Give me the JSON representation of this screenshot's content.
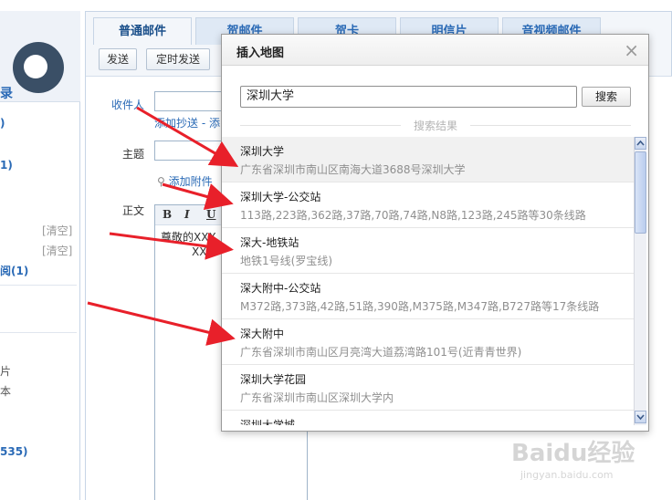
{
  "sidebar": {
    "logo_text": "录",
    "items": [
      {
        "text": ")"
      },
      {
        "text": "1)"
      },
      {
        "text": "[清空]"
      },
      {
        "text": "[清空]"
      },
      {
        "text": "阅(1)"
      },
      {
        "text": "片"
      },
      {
        "text": "本"
      },
      {
        "text": "535)"
      }
    ]
  },
  "tabs": [
    "普通邮件",
    "贺邮件",
    "贺卡",
    "明信片",
    "音视频邮件"
  ],
  "toolbar": {
    "send": "发送",
    "timed_send": "定时发送"
  },
  "compose": {
    "recipient_label": "收件人",
    "add_cc": "添加抄送 - 添",
    "subject_label": "主题",
    "attach": "添加附件",
    "body_label": "正文",
    "fmt_bold": "B",
    "fmt_italic": "I",
    "fmt_underline": "U",
    "greeting": "尊敬的XXX",
    "greeting2": "XXX"
  },
  "dialog": {
    "title": "插入地图",
    "close": "×",
    "search_value": "深圳大学",
    "search_button": "搜索",
    "results_label": "搜索结果",
    "results": [
      {
        "name": "深圳大学",
        "addr": "广东省深圳市南山区南海大道3688号深圳大学"
      },
      {
        "name": "深圳大学-公交站",
        "addr": "113路,223路,362路,37路,70路,74路,N8路,123路,245路等30条线路"
      },
      {
        "name": "深大-地铁站",
        "addr": "地铁1号线(罗宝线)"
      },
      {
        "name": "深大附中-公交站",
        "addr": "M372路,373路,42路,51路,390路,M375路,M347路,B727路等17条线路"
      },
      {
        "name": "深大附中",
        "addr": "广东省深圳市南山区月亮湾大道荔湾路101号(近青青世界)"
      },
      {
        "name": "深圳大学花园",
        "addr": "广东省深圳市南山区深圳大学内"
      },
      {
        "name": "深圳大学城",
        "addr": ""
      }
    ]
  },
  "watermark": {
    "logo": "Baidu经验",
    "sub": "jingyan.baidu.com"
  },
  "colors": {
    "accent": "#2a6ab6",
    "arrow": "#e8202a"
  }
}
